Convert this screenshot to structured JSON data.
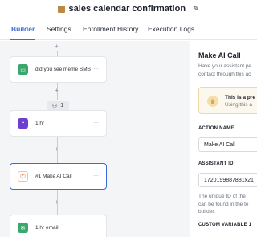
{
  "header": {
    "title": "sales calendar confirmation"
  },
  "tabs": [
    {
      "label": "Builder"
    },
    {
      "label": "Settings"
    },
    {
      "label": "Enrollment History"
    },
    {
      "label": "Execution Logs"
    }
  ],
  "workflow": {
    "nodes": [
      {
        "label": "did you see meme SMS",
        "icon": "sms-icon",
        "color": "#3aa76d"
      },
      {
        "label": "1 hr",
        "icon": "clock-icon",
        "color": "#6c3fd1"
      },
      {
        "label": "#1 Make AI Call",
        "icon": "phone-icon",
        "color": "#e46f33"
      },
      {
        "label": "1 hr email",
        "icon": "email-icon",
        "color": "#3aa76d"
      }
    ],
    "branch_badge": {
      "count": "1",
      "icon": "users-icon"
    }
  },
  "panel": {
    "title": "Make AI Call",
    "description_lines": [
      "Have your assistant pe",
      "contact through this ac"
    ],
    "notice": {
      "title": "This is a pre",
      "subtitle": "Using this a",
      "icon": "crown-icon"
    },
    "action_name": {
      "label": "ACTION NAME",
      "value": "Make AI Call"
    },
    "assistant_id": {
      "label": "ASSISTANT ID",
      "value": "1720199887881x21",
      "hint_lines": [
        "The unique ID of the",
        "can be found in the te",
        "builder."
      ]
    },
    "custom_variable": {
      "label": "CUSTOM VARIABLE 1"
    }
  },
  "colors": {
    "accent": "#3b6bd6",
    "notice_bg": "#fdf8ee",
    "canvas_bg": "#f4f5f7"
  }
}
